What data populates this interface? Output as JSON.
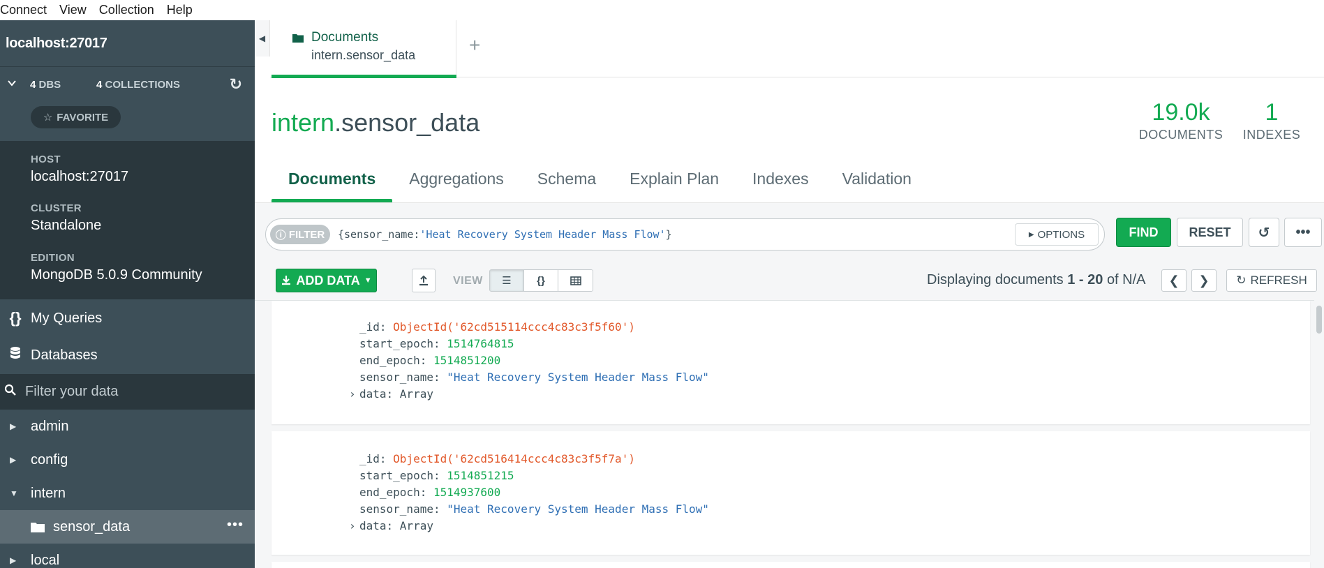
{
  "menu": [
    "Connect",
    "View",
    "Collection",
    "Help"
  ],
  "sidebar": {
    "host_title": "localhost:27017",
    "dbs_count": "4",
    "dbs_label": "DBS",
    "collections_count": "4",
    "collections_label": "COLLECTIONS",
    "favorite_label": "FAVORITE",
    "host_label": "HOST",
    "host_value": "localhost:27017",
    "cluster_label": "CLUSTER",
    "cluster_value": "Standalone",
    "edition_label": "EDITION",
    "edition_value": "MongoDB 5.0.9 Community",
    "my_queries": "My Queries",
    "databases": "Databases",
    "filter_placeholder": "Filter your data",
    "tree": [
      {
        "label": "admin",
        "expanded": false
      },
      {
        "label": "config",
        "expanded": false
      },
      {
        "label": "intern",
        "expanded": true
      },
      {
        "label": "sensor_data",
        "selected": true
      },
      {
        "label": "local",
        "expanded": false
      }
    ]
  },
  "tab": {
    "title": "Documents",
    "subtitle": "intern.sensor_data",
    "add_label": "+"
  },
  "header": {
    "db_name": "intern",
    "dot": ".",
    "collection_name": "sensor_data",
    "documents_count": "19.0k",
    "documents_label": "DOCUMENTS",
    "indexes_count": "1",
    "indexes_label": "INDEXES"
  },
  "subtabs": [
    "Documents",
    "Aggregations",
    "Schema",
    "Explain Plan",
    "Indexes",
    "Validation"
  ],
  "query": {
    "filter_label": "FILTER",
    "filter_prefix": "{sensor_name:",
    "filter_string": "'Heat Recovery System Header Mass Flow'",
    "filter_suffix": "}",
    "options_label": "OPTIONS",
    "find_label": "FIND",
    "reset_label": "RESET"
  },
  "toolbar": {
    "add_data_label": "ADD DATA",
    "view_label": "VIEW",
    "paging_prefix": "Displaying documents",
    "paging_range": "1 - 20",
    "paging_of": "of N/A",
    "refresh_label": "REFRESH"
  },
  "documents": [
    {
      "id_key": "_id",
      "id_value": "ObjectId('62cd515114ccc4c83c3f5f60')",
      "start_key": "start_epoch",
      "start_value": "1514764815",
      "end_key": "end_epoch",
      "end_value": "1514851200",
      "sensor_key": "sensor_name",
      "sensor_value": "\"Heat Recovery System Header Mass Flow\"",
      "data_key": "data",
      "data_value": "Array"
    },
    {
      "id_key": "_id",
      "id_value": "ObjectId('62cd516414ccc4c83c3f5f7a')",
      "start_key": "start_epoch",
      "start_value": "1514851215",
      "end_key": "end_epoch",
      "end_value": "1514937600",
      "sensor_key": "sensor_name",
      "sensor_value": "\"Heat Recovery System Header Mass Flow\"",
      "data_key": "data",
      "data_value": "Array"
    }
  ],
  "colors": {
    "accent_green": "#13aa52",
    "dark_green": "#116149",
    "sidebar_bg": "#3d4f58",
    "objectid_orange": "#e2592b",
    "string_blue": "#2f6fb4"
  }
}
